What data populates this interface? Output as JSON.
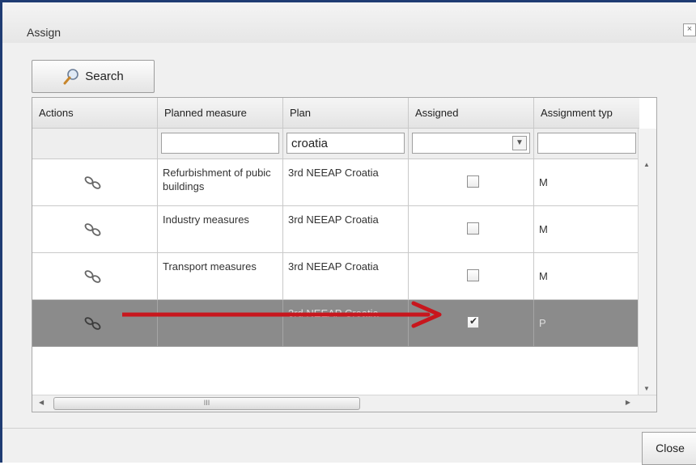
{
  "dialog": {
    "title": "Assign",
    "close_glyph": "×",
    "search_label": "Search",
    "close_label": "Close"
  },
  "grid": {
    "columns": [
      "Actions",
      "Planned measure",
      "Plan",
      "Assigned",
      "Assignment typ"
    ],
    "filters": {
      "planned_measure": "",
      "plan": "croatia",
      "assigned": "",
      "assignment_type": ""
    },
    "rows": [
      {
        "measure": "Refurbishment of pubic buildings",
        "plan": "3rd NEEAP Croatia",
        "assigned": false,
        "type": "M",
        "selected": false
      },
      {
        "measure": "Industry measures",
        "plan": "3rd NEEAP Croatia",
        "assigned": false,
        "type": "M",
        "selected": false
      },
      {
        "measure": "Transport measures",
        "plan": "3rd NEEAP Croatia",
        "assigned": false,
        "type": "M",
        "selected": false
      },
      {
        "measure": "",
        "plan": "3rd NEEAP Croatia",
        "assigned": true,
        "type": "P",
        "selected": true
      }
    ],
    "hscroll_thumb_label": "III"
  },
  "colors": {
    "frame": "#1f3c73",
    "selected_row": "#8b8b8b",
    "annotation_arrow": "#c8161d"
  },
  "icons": {
    "search": "magnifier-icon",
    "row_action": "link-chain-icon"
  }
}
